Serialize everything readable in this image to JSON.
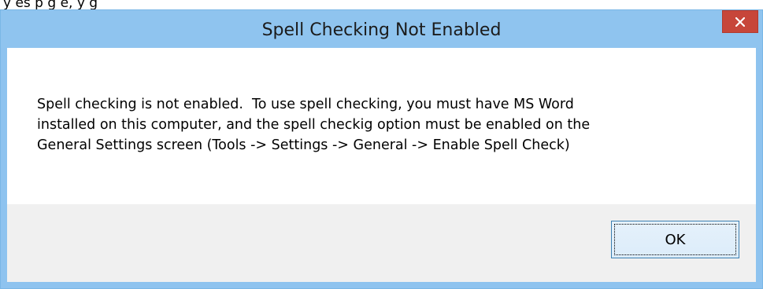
{
  "background_window": {
    "partial_text": "y          es          p                                g          e,        y                                           g"
  },
  "dialog": {
    "title": "Spell Checking Not Enabled",
    "close_icon": "close-icon",
    "message": "Spell checking is not enabled.  To use spell checking, you must have MS Word\ninstalled on this computer, and the spell checkig option must be enabled on the\nGeneral Settings screen (Tools -> Settings -> General -> Enable Spell Check)",
    "ok_label": "OK"
  },
  "colors": {
    "title_bar": "#8fc4ef",
    "close_button": "#c7463a",
    "footer": "#f0f0f0"
  }
}
